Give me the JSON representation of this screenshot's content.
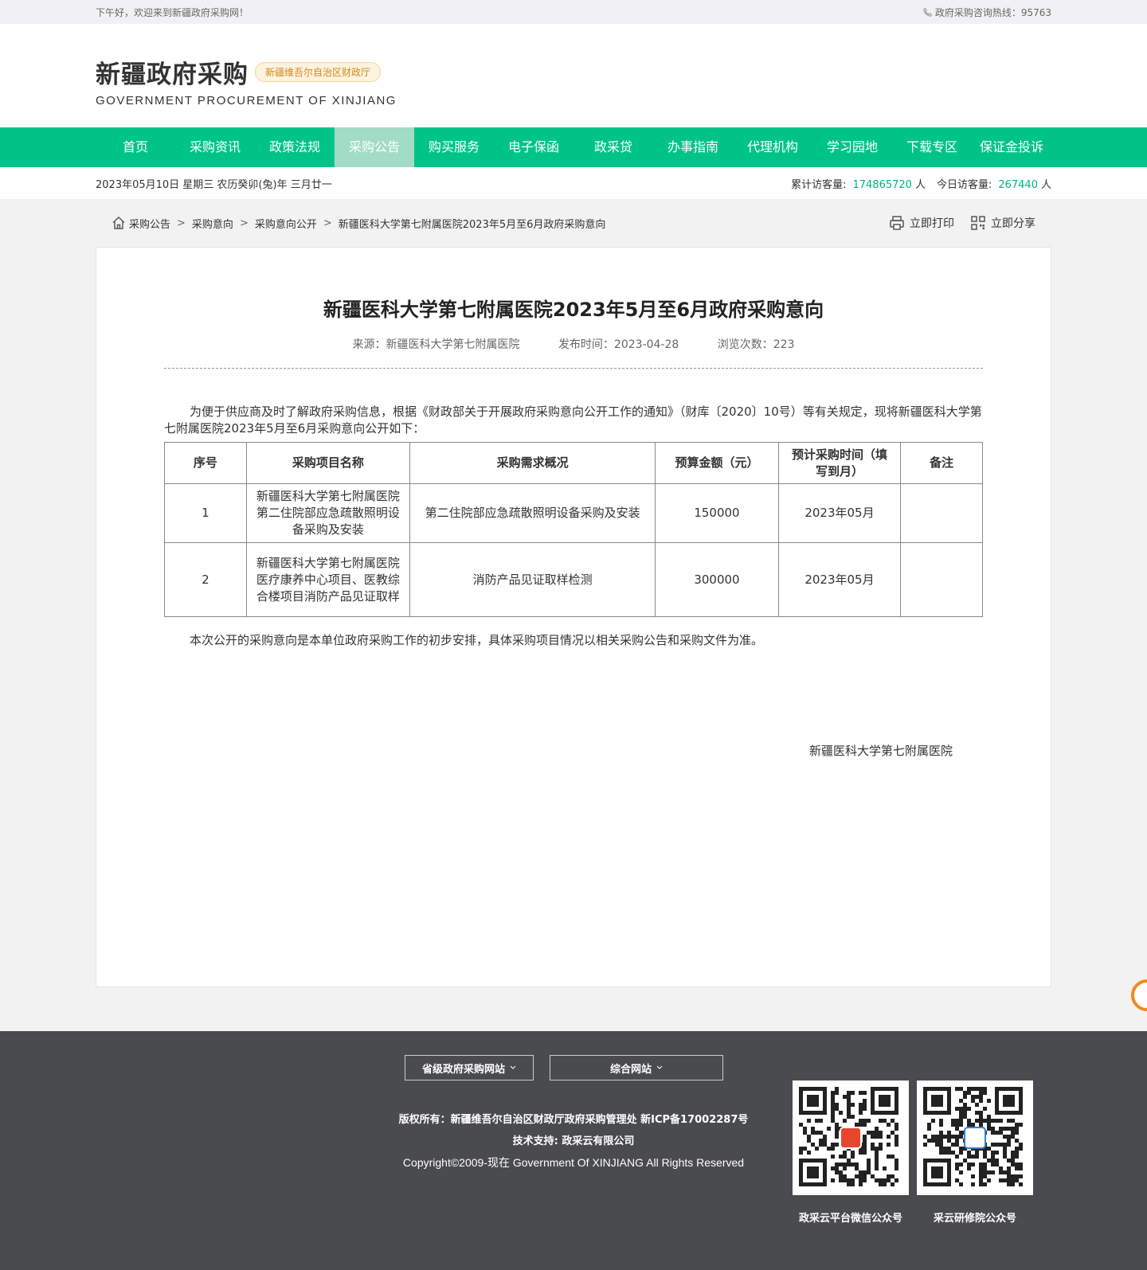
{
  "topbar": {
    "greeting": "下午好，欢迎来到新疆政府采购网！",
    "hotline": "政府采购咨询热线：95763"
  },
  "header": {
    "logo_cn": "新疆政府采购",
    "logo_badge": "新疆维吾尔自治区财政厅",
    "logo_en": "GOVERNMENT PROCUREMENT OF XINJIANG"
  },
  "nav": {
    "items": [
      "首页",
      "采购资讯",
      "政策法规",
      "采购公告",
      "购买服务",
      "电子保函",
      "政采贷",
      "办事指南",
      "代理机构",
      "学习园地",
      "下载专区",
      "保证金投诉"
    ],
    "active": "采购公告",
    "accent": "#00c487"
  },
  "datebar": {
    "date": "2023年05月10日 星期三 农历癸卯(兔)年 三月廿一",
    "total_label": "累计访客量:",
    "total_value": "174865720",
    "today_label": "今日访客量:",
    "today_value": "267440",
    "unit": "人"
  },
  "breadcrumb": {
    "items": [
      "采购公告",
      "采购意向",
      "采购意向公开",
      "新疆医科大学第七附属医院2023年5月至6月政府采购意向"
    ],
    "separator": ">",
    "print_label": "立即打印",
    "share_label": "立即分享"
  },
  "article": {
    "title": "新疆医科大学第七附属医院2023年5月至6月政府采购意向",
    "source": "来源：新疆医科大学第七附属医院",
    "publish_time": "发布时间：2023-04-28",
    "views": "浏览次数：223",
    "intro": "为便于供应商及时了解政府采购信息，根据《财政部关于开展政府采购意向公开工作的通知》（财库〔2020〕10号）等有关规定，现将新疆医科大学第七附属医院2023年5月至6月采购意向公开如下：",
    "table": {
      "headers": [
        "序号",
        "采购项目名称",
        "采购需求概况",
        "预算金额（元）",
        "预计采购时间（填写到月）",
        "备注"
      ],
      "rows": [
        [
          "1",
          "新疆医科大学第七附属医院第二住院部应急疏散照明设备采购及安装",
          "第二住院部应急疏散照明设备采购及安装",
          "150000",
          "2023年05月",
          ""
        ],
        [
          "2",
          "新疆医科大学第七附属医院医疗康养中心项目、医教综合楼项目消防产品见证取样",
          "消防产品见证取样检测",
          "300000",
          "2023年05月",
          ""
        ]
      ]
    },
    "note": "本次公开的采购意向是本单位政府采购工作的初步安排，具体采购项目情况以相关采购公告和采购文件为准。",
    "signature": "新疆医科大学第七附属医院"
  },
  "footer": {
    "select1": "省级政府采购网站",
    "select2": "综合网站",
    "copyright": "版权所有：新疆维吾尔自治区财政厅政府采购管理处 新ICP备17002287号",
    "support": "技术支持: 政采云有限公司",
    "copyright_en": "Copyright©2009-现在 Government Of XINJIANG All Rights Reserved",
    "qr1_caption": "政采云平台微信公众号",
    "qr2_caption": "采云研修院公众号"
  }
}
